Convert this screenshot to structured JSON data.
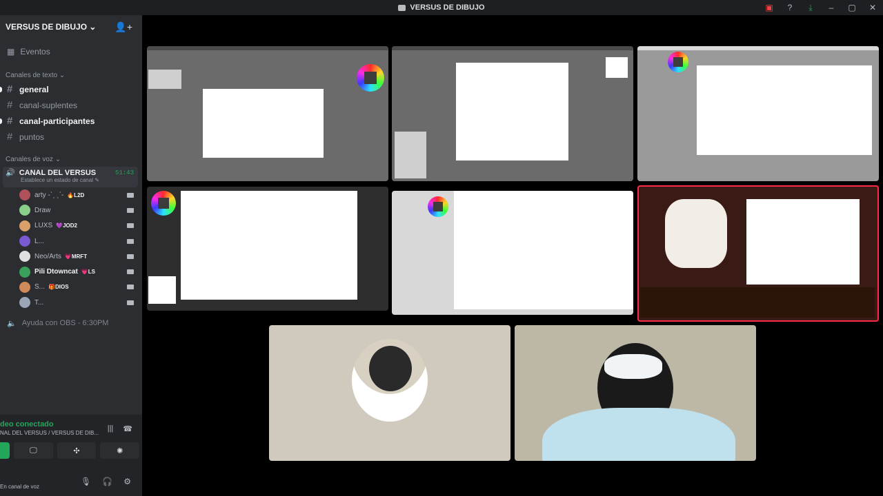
{
  "window": {
    "title": "VERSUS DE DIBUJO"
  },
  "server": {
    "name": "VERSUS DE DIBUJO ⌄"
  },
  "events_label": "Eventos",
  "text_category": "Canales de texto ⌄",
  "text_channels": [
    {
      "label": "general",
      "unread": true
    },
    {
      "label": "canal-suplentes",
      "unread": false
    },
    {
      "label": "canal-participantes",
      "unread": true
    },
    {
      "label": "puntos",
      "unread": false
    }
  ],
  "voice_category": "Canales de voz ⌄",
  "voice_channel": {
    "label": "CANAL DEL VERSUS",
    "timer": "51:43",
    "status": "Establece un estado de canal ✎"
  },
  "members": [
    {
      "name": "arty -ˋˏ ˎˊ-",
      "badge": "🔥L2D",
      "color": "#b0505a"
    },
    {
      "name": "Draw",
      "badge": "",
      "color": "#8ad08a"
    },
    {
      "name": "LUXS",
      "badge": "💜JOD2",
      "color": "#d9a06a"
    },
    {
      "name": "L...",
      "badge": "",
      "color": "#7a5ad0"
    },
    {
      "name": "Neo/Arts",
      "badge": "💗MRFT",
      "color": "#e0e0e0"
    },
    {
      "name": "Pili Dtowncat",
      "badge": "💗LS",
      "color": "#3aa05a",
      "bold": true
    },
    {
      "name": "S...",
      "badge": "🎁DIOS",
      "color": "#d08a5a"
    },
    {
      "name": "T...",
      "badge": "",
      "color": "#9aa6b8"
    }
  ],
  "voice_channel_2": "Ayuda con OBS - 6:30PM",
  "panel": {
    "status": "deo conectado",
    "location": "NAL DEL VERSUS / VERSUS DE DIB...",
    "user_status": "En canal de voz"
  },
  "icons": {
    "title_logo": "discord-logo-icon",
    "screen": "screen-share-icon",
    "help": "help-icon",
    "download": "download-icon",
    "add_member": "add-member-icon",
    "calendar": "calendar-icon",
    "hash": "hash-icon",
    "speaker": "speaker-icon",
    "camera": "camera-icon"
  },
  "colors": {
    "accent_green": "#23a55a",
    "danger": "#f23f42",
    "sidebar": "#2b2d31"
  }
}
